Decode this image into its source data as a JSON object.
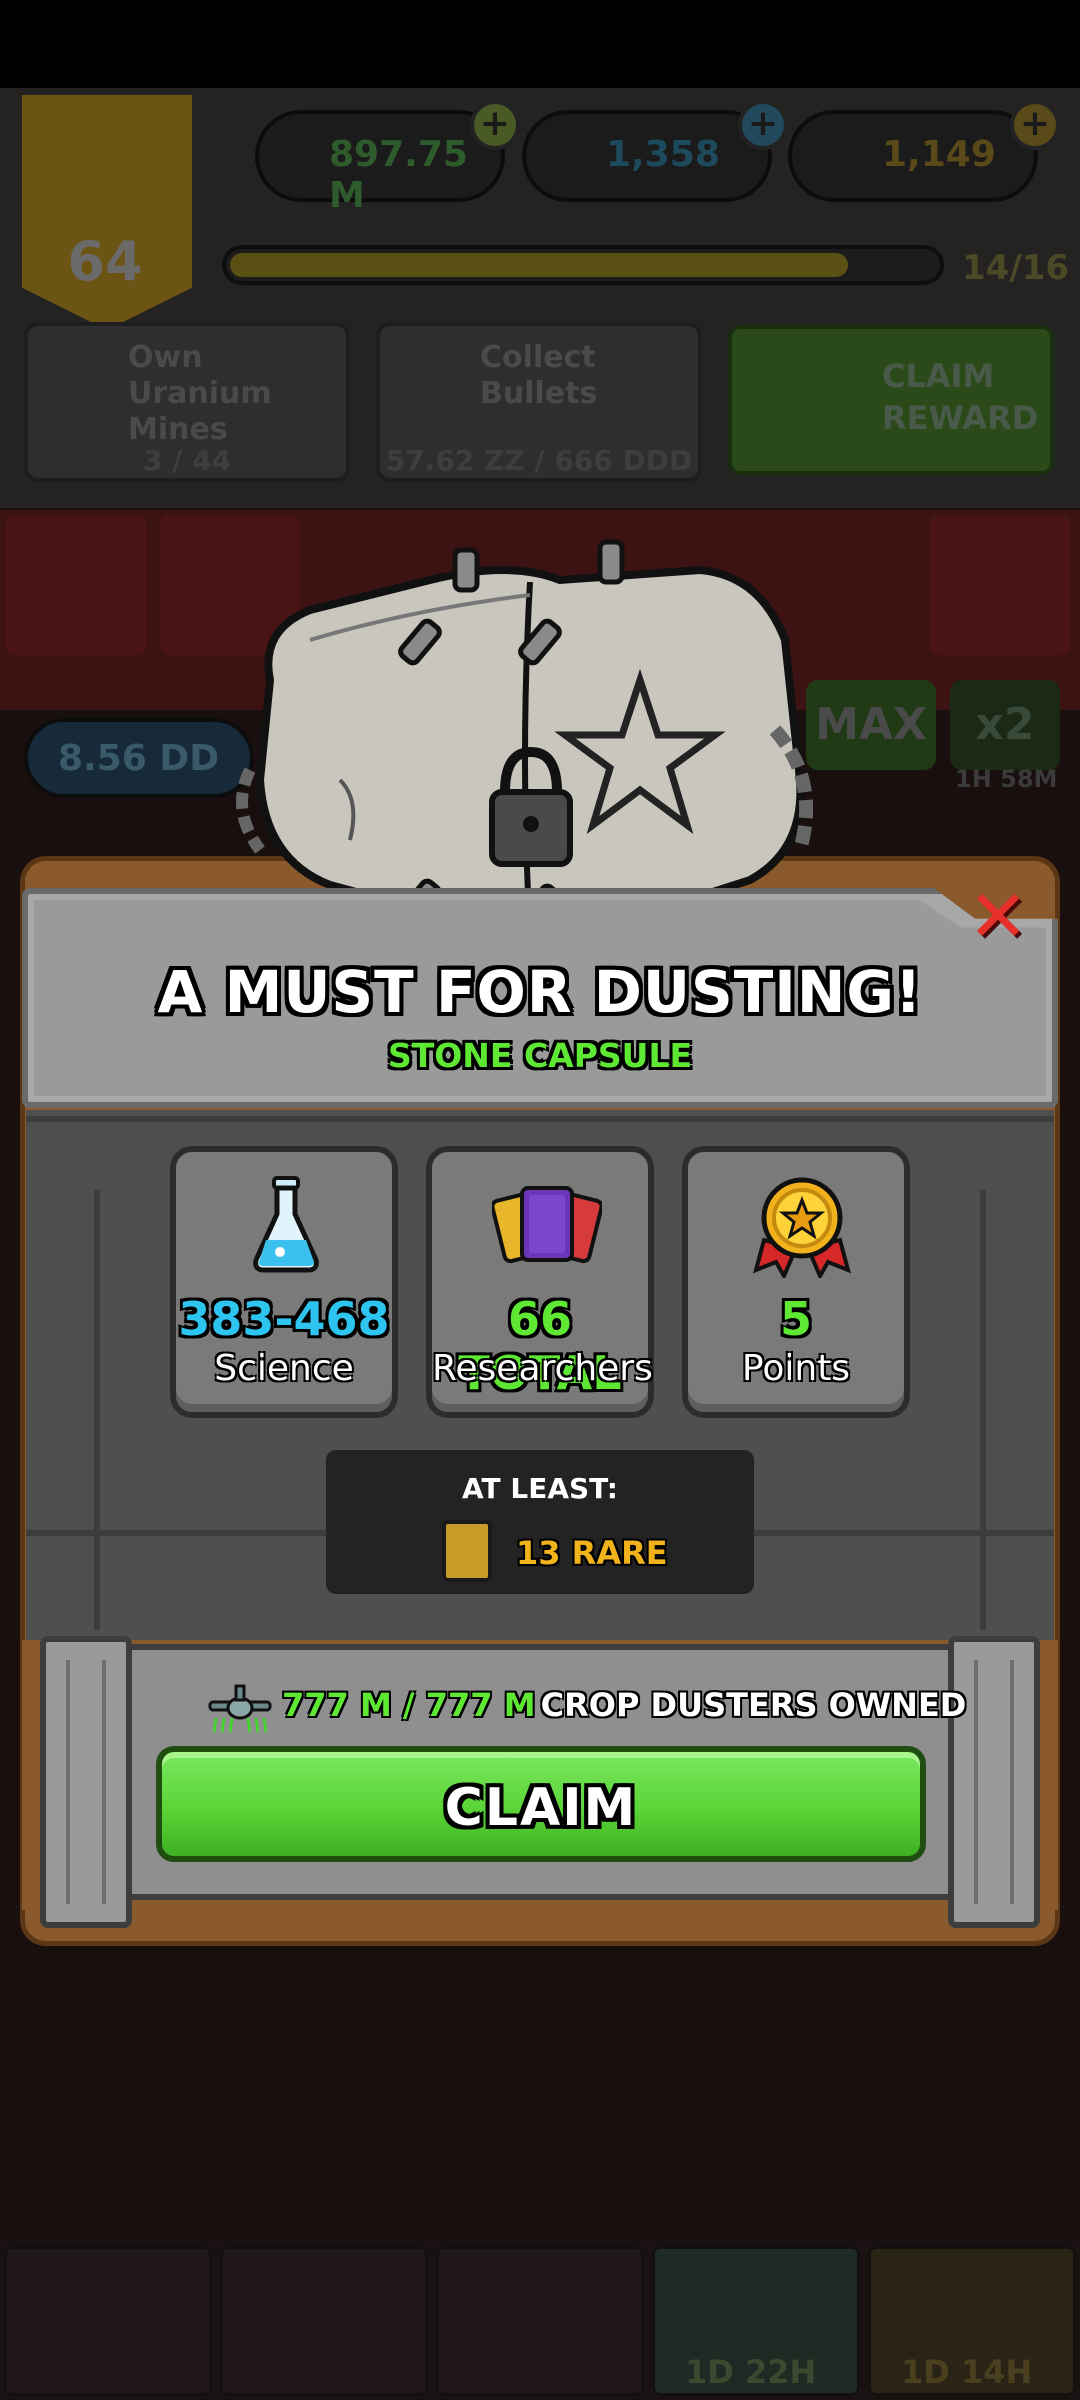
{
  "hud": {
    "level": "64",
    "cash": "897.75 M",
    "science": "1,358",
    "gold": "1,149",
    "plus": "+",
    "xp_progress": "14/16",
    "xp_fraction": 0.875
  },
  "quests": [
    {
      "title": "Own Uranium Mines",
      "progress": "3 / 44"
    },
    {
      "title": "Collect Bullets",
      "progress": "57.62 ZZ / 666 DDD"
    }
  ],
  "claim_reward_label": "CLAIM REWARD",
  "background": {
    "amount_pill": "8.56 DD",
    "max_label": "MAX",
    "boost_label": "x2",
    "boost_timer": "1H 58M",
    "nav_timer_1": "1D 22H",
    "nav_timer_2": "1D 14H"
  },
  "modal": {
    "close_glyph": "✕",
    "title": "A MUST FOR DUSTING!",
    "subtitle": "STONE CAPSULE",
    "stats": [
      {
        "value": "383-468",
        "label": "Science",
        "color": "#2ec4f0",
        "icon": "flask-icon"
      },
      {
        "value": "66 TOTAL",
        "label": "Researchers",
        "color": "#5ee834",
        "icon": "cards-icon"
      },
      {
        "value": "5",
        "label": "Points",
        "color": "#5ee834",
        "icon": "medal-icon"
      }
    ],
    "at_least_label": "AT LEAST:",
    "rare_text": "13 RARE",
    "owned_count": "777 M / 777 M",
    "owned_label": "CROP DUSTERS OWNED",
    "claim_label": "CLAIM"
  },
  "colors": {
    "accent_green": "#5ee834",
    "science_blue": "#2ec4f0",
    "rare_gold": "#f2b21c",
    "close_red": "#e8302a"
  }
}
